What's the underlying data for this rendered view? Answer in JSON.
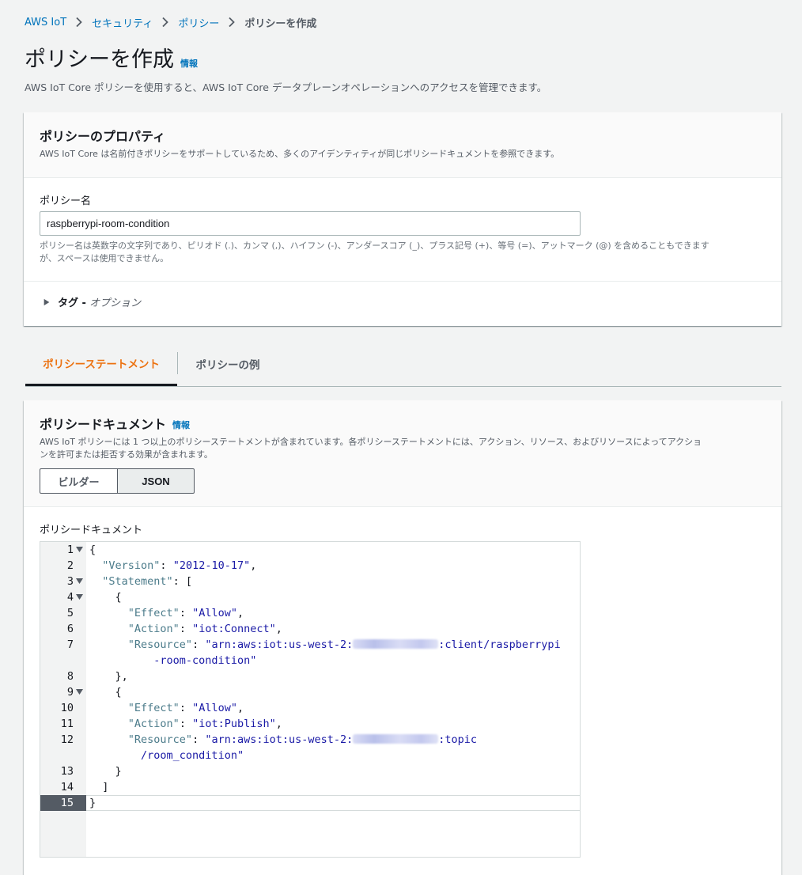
{
  "breadcrumb": {
    "items": [
      "AWS IoT",
      "セキュリティ",
      "ポリシー"
    ],
    "current": "ポリシーを作成"
  },
  "header": {
    "title": "ポリシーを作成",
    "info": "情報",
    "description": "AWS IoT Core ポリシーを使用すると、AWS IoT Core データプレーンオペレーションへのアクセスを管理できます。"
  },
  "properties": {
    "title": "ポリシーのプロパティ",
    "description": "AWS IoT Core は名前付きポリシーをサポートしているため、多くのアイデンティティが同じポリシードキュメントを参照できます。",
    "name_label": "ポリシー名",
    "name_value": "raspberrypi-room-condition",
    "constraint_line1": "ポリシー名は英数字の文字列であり、ピリオド (.)、カンマ (,)、ハイフン (-)、アンダースコア (_)、プラス記号 (+)、等号 (=)、アットマーク (@) を含めることもできます",
    "constraint_line2": "が、スペースは使用できません。",
    "tags_label": "タグ -",
    "tags_optional": "オプション"
  },
  "tabs": [
    {
      "label": "ポリシーステートメント",
      "active": true
    },
    {
      "label": "ポリシーの例",
      "active": false
    }
  ],
  "document": {
    "title": "ポリシードキュメント",
    "info": "情報",
    "description_line1": "AWS IoT ポリシーには 1 つ以上のポリシーステートメントが含まれています。各ポリシーステートメントには、アクション、リソース、およびリソースによってアクショ",
    "description_line2": "ンを許可または拒否する効果が含まれます。",
    "mode_builder": "ビルダー",
    "mode_json": "JSON",
    "mode_selected": "JSON",
    "editor_label": "ポリシードキュメント"
  },
  "code": {
    "version_key": "\"Version\"",
    "version_val": "\"2012-10-17\"",
    "statement_key": "\"Statement\"",
    "effect_key": "\"Effect\"",
    "allow_val": "\"Allow\"",
    "action_key": "\"Action\"",
    "connect_val": "\"iot:Connect\"",
    "publish_val": "\"iot:Publish\"",
    "resource_key": "\"Resource\"",
    "arn_prefix": "\"arn:aws:iot:us-west-2:",
    "client_suffix": ":client/raspberrypi",
    "client_wrap": "-room-condition\"",
    "topic_suffix": ":topic",
    "topic_wrap": "/room_condition\"",
    "line_numbers": [
      "1",
      "2",
      "3",
      "4",
      "5",
      "6",
      "7",
      "8",
      "9",
      "10",
      "11",
      "12",
      "13",
      "14",
      "15"
    ],
    "active_line": 15
  },
  "colors": {
    "accent_orange": "#ec7211",
    "link_blue": "#0073bb",
    "code_key": "#4b7b8a",
    "code_string": "#1a1aa6"
  }
}
